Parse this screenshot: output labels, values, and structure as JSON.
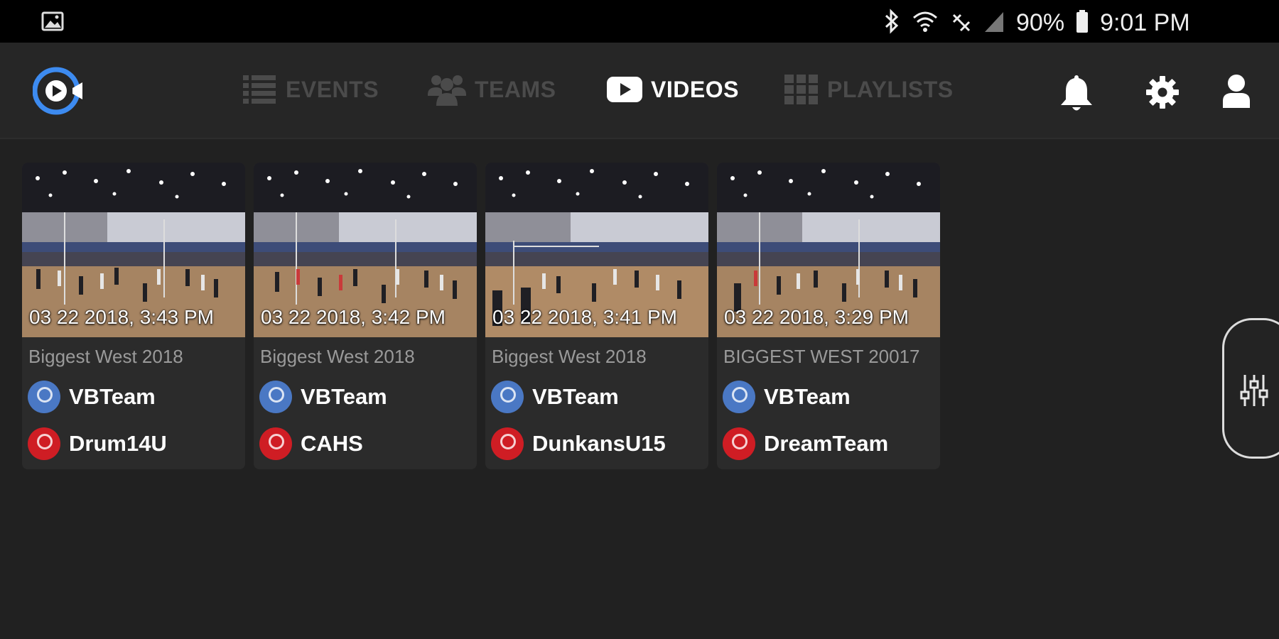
{
  "status_bar": {
    "battery": "90%",
    "time": "9:01 PM",
    "icons": [
      "image-icon",
      "bluetooth-icon",
      "wifi-icon",
      "data-icon",
      "signal-icon",
      "battery-icon"
    ]
  },
  "app": {
    "logo": "video-camera-logo",
    "accent": "#3d8bf0"
  },
  "nav": {
    "events": "EVENTS",
    "teams": "TEAMS",
    "videos": "VIDEOS",
    "playlists": "PLAYLISTS",
    "active": "videos"
  },
  "actions": [
    "bell-icon",
    "gear-icon",
    "user-icon"
  ],
  "videos": [
    {
      "date": "03 22 2018, 3:43 PM",
      "event": "Biggest West 2018",
      "team1": "VBTeam",
      "team2": "Drum14U"
    },
    {
      "date": "03 22 2018, 3:42 PM",
      "event": "Biggest West 2018",
      "team1": "VBTeam",
      "team2": "CAHS"
    },
    {
      "date": "03 22 2018, 3:41 PM",
      "event": "Biggest West 2018",
      "team1": "VBTeam",
      "team2": "DunkansU15"
    },
    {
      "date": "03 22 2018, 3:29 PM",
      "event": "BIGGEST WEST 20017",
      "team1": "VBTeam",
      "team2": "DreamTeam"
    }
  ],
  "colors": {
    "background": "#212121",
    "card": "#2b2b2b",
    "team1_badge": "#4a78c4",
    "team2_badge": "#cf1d24"
  }
}
